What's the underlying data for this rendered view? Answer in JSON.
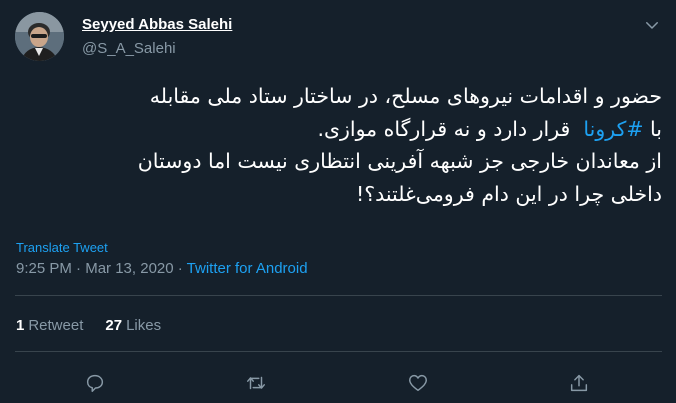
{
  "author": {
    "display_name": "Seyyed Abbas Salehi",
    "handle": "@S_A_Salehi",
    "avatar_icon": "profile-photo"
  },
  "tweet": {
    "line1": "حضور و اقدامات نیروهای مسلح، در ساختار ستاد ملی مقابله",
    "line2_start": "با",
    "hashtag": "#کرونا",
    "line2_end": "قرار دارد و نه قرارگاه موازی.",
    "line3": "از معاندان خارجی جز شبهه آفرینی انتظاری نیست اما دوستان",
    "line4": "داخلی چرا در این دام فرومی‌غلتند؟!"
  },
  "translate_label": "Translate Tweet",
  "meta": {
    "time": "9:25 PM",
    "separator1": " · ",
    "date": "Mar 13, 2020",
    "separator2": " · ",
    "source": "Twitter for Android"
  },
  "stats": {
    "retweets_count": "1",
    "retweets_label": "Retweet",
    "likes_count": "27",
    "likes_label": "Likes"
  },
  "actions": [
    "reply-icon",
    "retweet-icon",
    "like-icon",
    "share-icon"
  ],
  "colors": {
    "background": "#15202b",
    "text": "#ffffff",
    "muted": "#8899a6",
    "accent": "#1da1f2",
    "divider": "#38444d"
  }
}
